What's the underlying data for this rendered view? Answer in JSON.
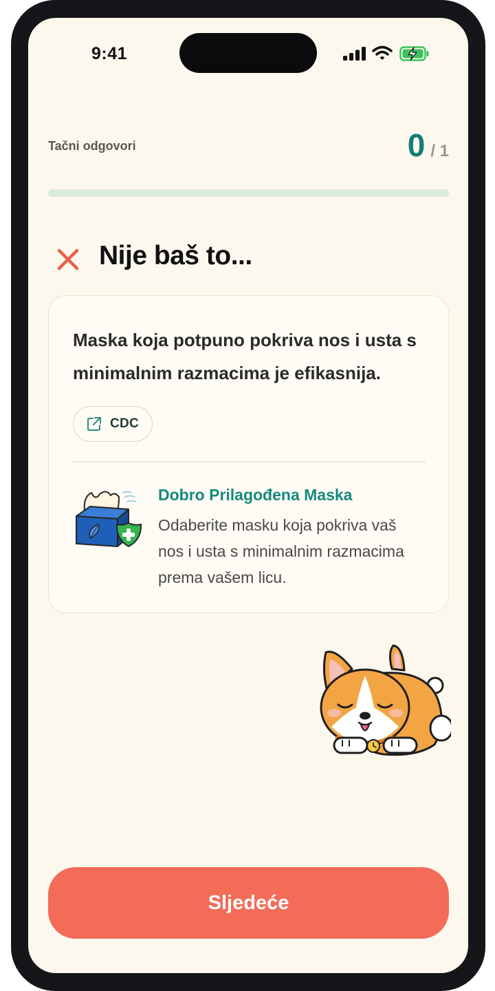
{
  "status_bar": {
    "time": "9:41",
    "icons": [
      "signal-icon",
      "wifi-icon",
      "battery-charging-icon"
    ]
  },
  "quiz": {
    "score_label": "Tačni odgovori",
    "score_value": "0",
    "score_total": "/ 1",
    "progress_fraction": 0
  },
  "result": {
    "icon": "close-icon",
    "heading": "Nije baš to...",
    "color": "#e8604a"
  },
  "card": {
    "statement": "Maska koja potpuno pokriva nos i usta s minimalnim razmacima je efikasnija.",
    "source_label": "CDC",
    "source_icon": "external-link-icon",
    "tip": {
      "icon": "tissue-box-shield-icon",
      "title": "Dobro Prilagođena Maska",
      "body": "Odaberite masku koja pokriva vaš nos i usta s minimalnim razmacima prema vašem licu."
    }
  },
  "mascot": "sleeping-corgi-icon",
  "footer": {
    "next_label": "Sljedeće"
  },
  "colors": {
    "background": "#fdf8ee",
    "accent_teal": "#147e73",
    "button_coral": "#f26c58"
  }
}
